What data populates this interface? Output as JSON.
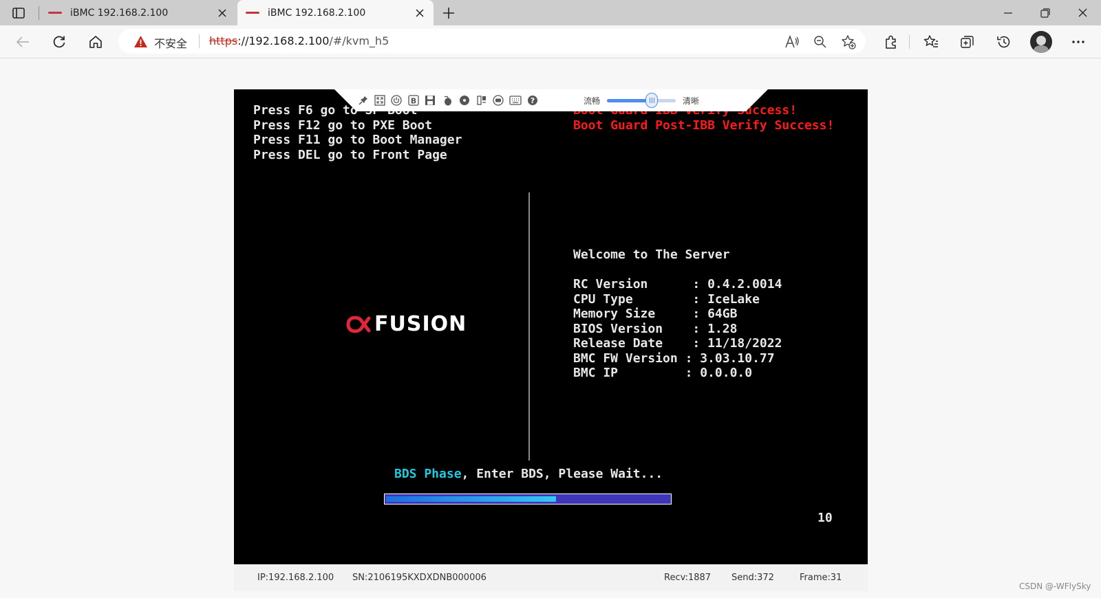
{
  "browser": {
    "tabs": [
      {
        "title": "iBMC 192.168.2.100",
        "active": false
      },
      {
        "title": "iBMC 192.168.2.100",
        "active": true
      }
    ],
    "security_label": "不安全",
    "url": {
      "protocol": "https",
      "host": "://192.168.2.100",
      "path": "/#/kvm_h5"
    }
  },
  "kvm": {
    "quality_labels": {
      "left": "流畅",
      "right": "清晰"
    },
    "quality_level": 0.65,
    "icons": [
      "pin-icon",
      "fullscreen-icon",
      "power-icon",
      "bold-b-icon",
      "floppy-disk-icon",
      "mouse-icon",
      "cd-disc-icon",
      "combo-key-icon",
      "record-icon",
      "keyboard-icon",
      "help-icon"
    ],
    "screen": {
      "boot_hints": [
        "Press F6 go to SP Boot",
        "Press F12 go to PXE Boot",
        "Press F11 go to Boot Manager",
        "Press DEL go to Front Page"
      ],
      "boot_guard": [
        "Boot Guard IBB Verify Success!",
        "Boot Guard Post-IBB Verify Success!"
      ],
      "logo_text": "FUSION",
      "welcome": "Welcome to The Server",
      "info": [
        {
          "label": "RC Version      ",
          "value": ": 0.4.2.0014"
        },
        {
          "label": "CPU Type        ",
          "value": ": IceLake"
        },
        {
          "label": "Memory Size     ",
          "value": ": 64GB"
        },
        {
          "label": "BIOS Version    ",
          "value": ": 1.28"
        },
        {
          "label": "Release Date    ",
          "value": ": 11/18/2022"
        },
        {
          "label": "BMC FW Version ",
          "value": ": 3.03.10.77"
        },
        {
          "label": "BMC IP         ",
          "value": ": 0.0.0.0"
        }
      ],
      "phase": {
        "name": "BDS Phase",
        "message": ", Enter BDS, Please Wait..."
      },
      "progress": 0.6,
      "counter": "10"
    },
    "status": {
      "ip": "IP:192.168.2.100",
      "sn": "SN:2106195KXDXDNB000006",
      "recv": "Recv:1887",
      "send": "Send:372",
      "frame": "Frame:31"
    }
  },
  "watermark": "CSDN @-WFlySky",
  "colors": {
    "console_red": "#ff1a1a",
    "console_cyan": "#1ecbe1",
    "progress_bg": "#3f35b8",
    "logo_accent": "#e0263a"
  }
}
